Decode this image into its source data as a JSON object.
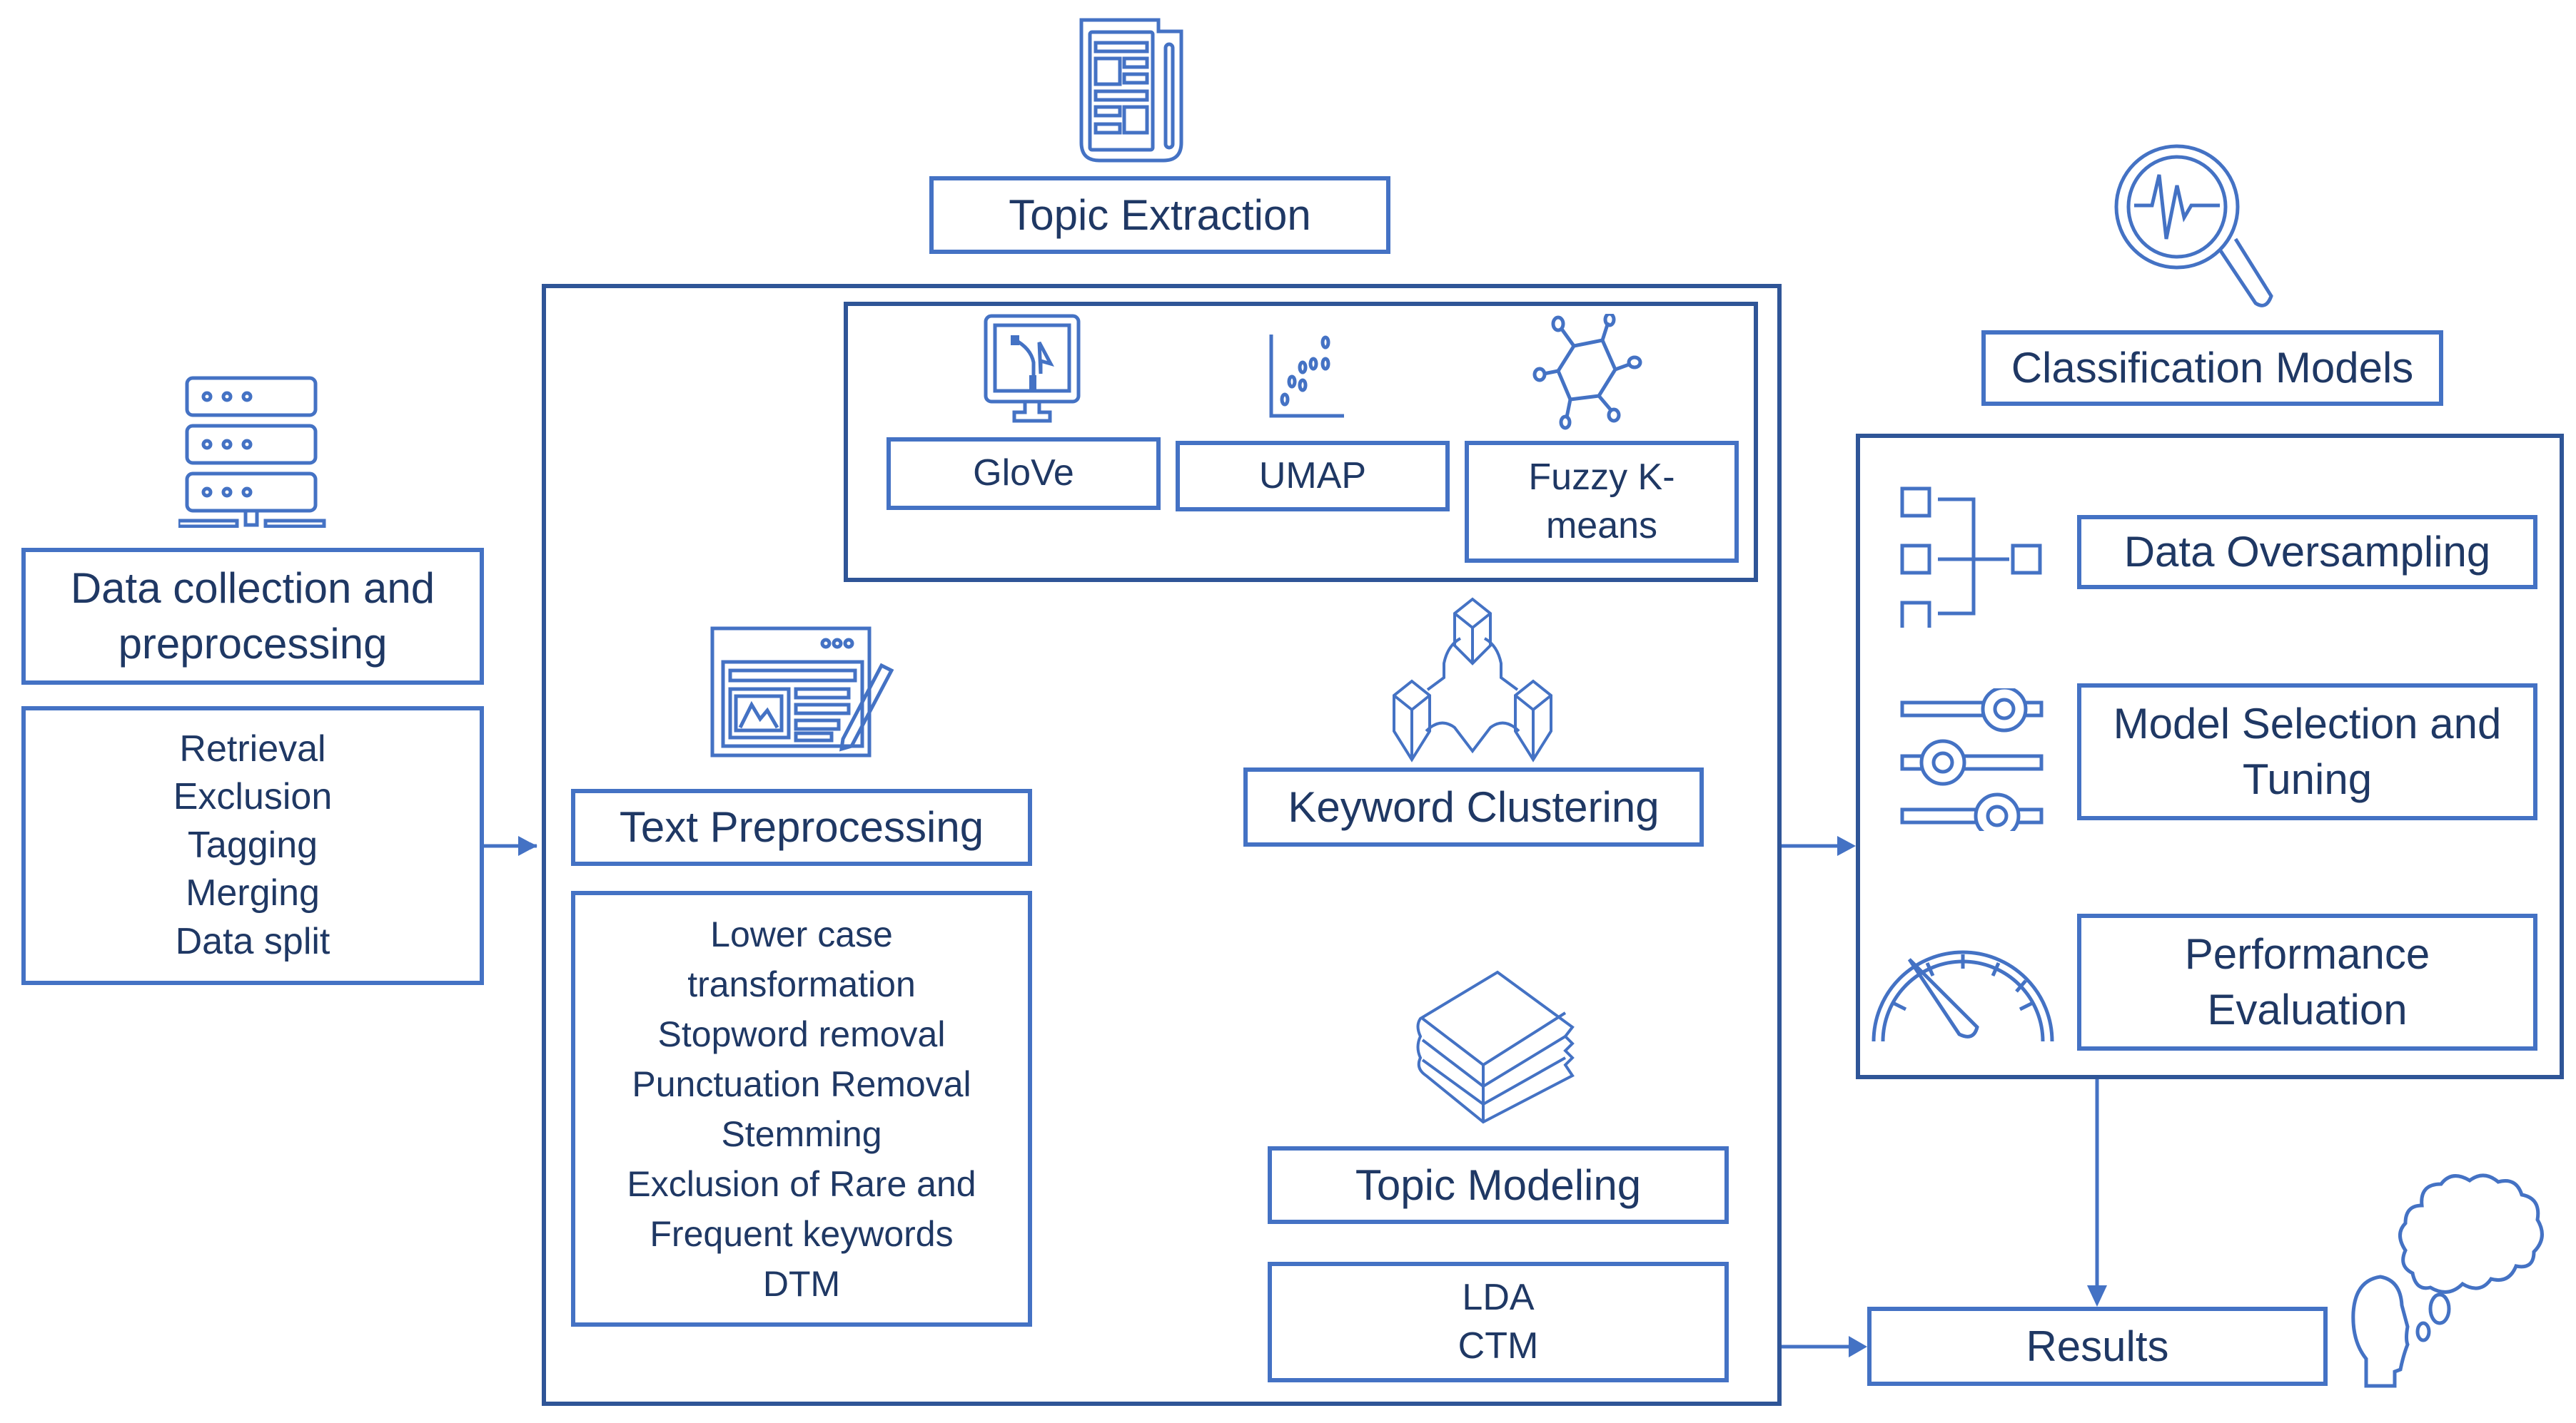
{
  "colors": {
    "border": "#4472c4",
    "container_border": "#2f5597",
    "text": "#1f3864"
  },
  "data_collection": {
    "title": "Data collection and preprocessing",
    "title_lines": [
      "Data collection and",
      "preprocessing"
    ],
    "steps": [
      "Retrieval",
      "Exclusion",
      "Tagging",
      "Merging",
      "Data split"
    ],
    "icon": "server-icon"
  },
  "topic_extraction": {
    "title": "Topic Extraction",
    "icon": "newspaper-icon",
    "methods": [
      {
        "label": "GloVe",
        "icon": "monitor-vector-icon"
      },
      {
        "label": "UMAP",
        "icon": "scatter-plot-icon"
      },
      {
        "label": "Fuzzy K-means",
        "label_lines": [
          "Fuzzy K-",
          "means"
        ],
        "icon": "cluster-network-icon"
      }
    ],
    "text_preprocessing": {
      "title": "Text Preprocessing",
      "icon": "document-edit-icon",
      "steps_lines": [
        "Lower case",
        "transformation",
        "Stopword removal",
        "Punctuation Removal",
        "Stemming",
        "Exclusion of Rare and",
        "Frequent keywords",
        "DTM"
      ]
    },
    "keyword_clustering": {
      "title": "Keyword Clustering",
      "icon": "linked-cubes-icon"
    },
    "topic_modeling": {
      "title": "Topic Modeling",
      "icon": "books-icon",
      "models": [
        "LDA",
        "CTM"
      ]
    }
  },
  "classification": {
    "title": "Classification Models",
    "icon": "magnifier-pulse-icon",
    "steps": [
      {
        "label": "Data Oversampling",
        "label_lines": [
          "Data Oversampling"
        ],
        "icon": "hierarchy-icon"
      },
      {
        "label": "Model Selection and Tuning",
        "label_lines": [
          "Model Selection and",
          "Tuning"
        ],
        "icon": "sliders-icon"
      },
      {
        "label": "Performance Evaluation",
        "label_lines": [
          "Performance",
          "Evaluation"
        ],
        "icon": "gauge-icon"
      }
    ]
  },
  "results": {
    "title": "Results",
    "icon": "thinking-head-icon"
  }
}
